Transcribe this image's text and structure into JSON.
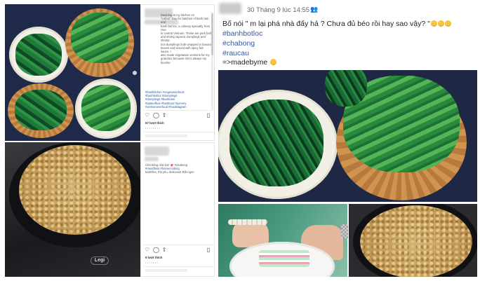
{
  "ig_post_1": {
    "caption_lines": [
      "Dawning at my kitchen on",
      "\"Lebon\" Day for batches of banh tam and",
      "banh bot loc, a culinary specialty from Hue",
      "in central Vietnam. These are pork belly",
      "and shrimp tapioca dumplings and shrimp",
      "rice dumplings both wrapped in banana",
      "leaves and served with spicy fish sauce. I",
      "also made vegetarian versions for my",
      "grandma because she's always my favorite"
    ],
    "hashtag_lines": [
      "#foodkitchen #vegetarianfood",
      "#banhbotloc #dumplings",
      "#dumplings #banhnam",
      "#tasteofhue #bestfood #yummy",
      "#vietnamesefood #foodstagram"
    ],
    "likes": "57 lượt thích",
    "timestamp": "• • • • • • • •"
  },
  "ig_post_2": {
    "caption_lines": [
      "Chà bông nhà làm 🐙 #chabong",
      "#meatfloss #homecooking"
    ],
    "caption_line_3": "banhflex, thịt yêu, delicious! Rất ngon",
    "likes": "9 lượt thích",
    "timestamp": "• • • • • • •"
  },
  "fb_post": {
    "timestamp": "30 Tháng 9 lúc 14:55",
    "audience_icon": "friends-icon",
    "line1": "Bố nói \" m lại phá nhà đấy hả ? Chưa đủ béo rồi hay sao vậy? \"",
    "tags": [
      "#banhbotloc",
      "#chabong",
      "#raucau"
    ],
    "signoff": "=>madebyme"
  },
  "photos": {
    "stove_brand": "Legi"
  },
  "colors": {
    "hashtag_blue": "#3b5998",
    "ig_link_blue": "#2b5b9c"
  }
}
